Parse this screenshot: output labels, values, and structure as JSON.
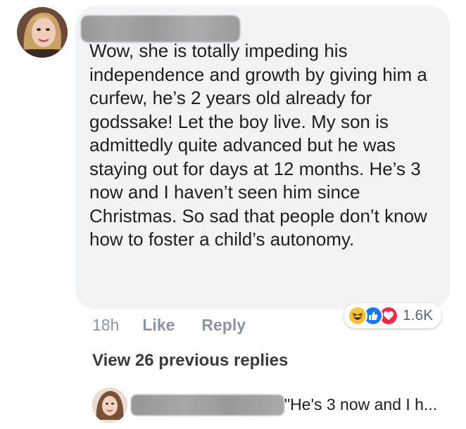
{
  "comment": {
    "avatar_icon": "user-avatar-photo",
    "text": "Wow, she is totally impeding his independence and growth by giving him a curfew, he’s 2 years old already for godssake! Let the boy live. My son is admittedly quite advanced but he was staying out for days at 12 months. He’s 3 now and I haven’t seen him since Christmas. So sad that people don’t know how to foster a child’s autonomy.",
    "time": "18h",
    "like_label": "Like",
    "reply_label": "Reply",
    "reactions": {
      "icons": [
        "haha-reaction-icon",
        "like-reaction-icon",
        "love-reaction-icon"
      ],
      "count": "1.6K",
      "colors": {
        "haha": "#f7c13f",
        "like": "#1877f2",
        "love": "#f0284a"
      }
    }
  },
  "view_previous_label": "View 26 previous replies",
  "reply": {
    "avatar_icon": "user-avatar-photo",
    "preview_text": "\"He's 3 now and I h..."
  },
  "colors": {
    "bubble_bg": "#f2f3f5",
    "meta_text": "#8d949e",
    "body_text": "#1c1e21"
  }
}
